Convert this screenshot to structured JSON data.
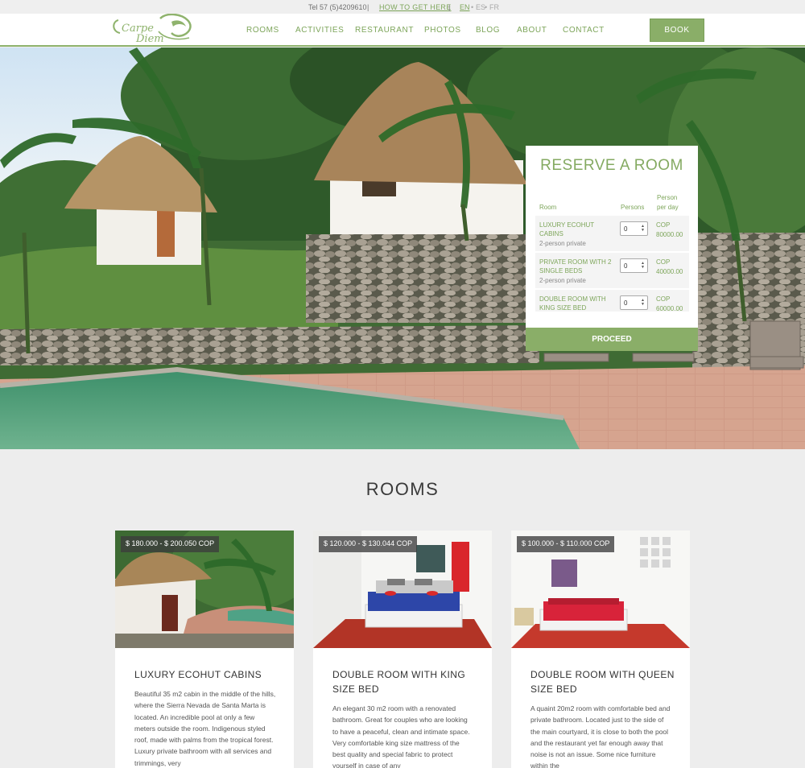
{
  "topbar": {
    "phone": "Tel 57 (5)4209610",
    "separator": "|",
    "how_to": "HOW TO GET HERE",
    "lang_en": "EN",
    "lang_es": "ES",
    "lang_fr": "FR",
    "lang_dot": "•"
  },
  "header": {
    "logo_text_1": "Carpe",
    "logo_text_2": "Diem",
    "nav": [
      "ROOMS",
      "ACTIVITIES",
      "RESTAURANT",
      "PHOTOS",
      "BLOG",
      "ABOUT",
      "CONTACT"
    ],
    "book_label": "BOOK"
  },
  "reserve": {
    "title": "RESERVE A ROOM",
    "col_room": "Room",
    "col_persons": "Persons",
    "col_price_1": "Person",
    "col_price_2": "per day",
    "rows": [
      {
        "name": "LUXURY ECOHUT CABINS",
        "sub": "2-person private",
        "persons": "0",
        "currency": "COP",
        "price": "80000.00"
      },
      {
        "name": "PRIVATE ROOM WITH 2 SINGLE BEDS",
        "sub": "2-person private",
        "persons": "0",
        "currency": "COP",
        "price": "40000.00"
      },
      {
        "name": "DOUBLE ROOM WITH KING SIZE BED",
        "sub": "",
        "persons": "0",
        "currency": "COP",
        "price": "60000.00"
      }
    ],
    "proceed_label": "PROCEED"
  },
  "rooms": {
    "title": "ROOMS",
    "cards": [
      {
        "price": "$ 180.000 - $ 200.050 COP",
        "title": "LUXURY ECOHUT CABINS",
        "description": "Beautiful 35 m2 cabin in the middle of the hills, where the Sierra Nevada de Santa Marta is located. An incredible pool at only a few meters outside the room. Indigenous styled roof, made with palms from the tropical forest. Luxury private bathroom with all services and trimmings, very"
      },
      {
        "price": "$ 120.000 - $ 130.044 COP",
        "title": "DOUBLE ROOM WITH KING SIZE BED",
        "description": "An elegant 30 m2 room with a renovated bathroom. Great for couples who are looking to have a peaceful, clean and intimate space. Very comfortable king size mattress of the best quality and special fabric to protect yourself in case of any"
      },
      {
        "price": "$ 100.000 - $ 110.000 COP",
        "title": "DOUBLE ROOM WITH QUEEN SIZE BED",
        "description": "A quaint 20m2 room with comfortable bed and private bathroom. Located just to the side of the main courtyard, it is close to both the pool and the restaurant yet far enough away that noise is not an issue. Some nice furniture within the"
      }
    ]
  },
  "colors": {
    "accent_green": "#8aae68",
    "text_green": "#7da55a",
    "background": "#ededed"
  }
}
